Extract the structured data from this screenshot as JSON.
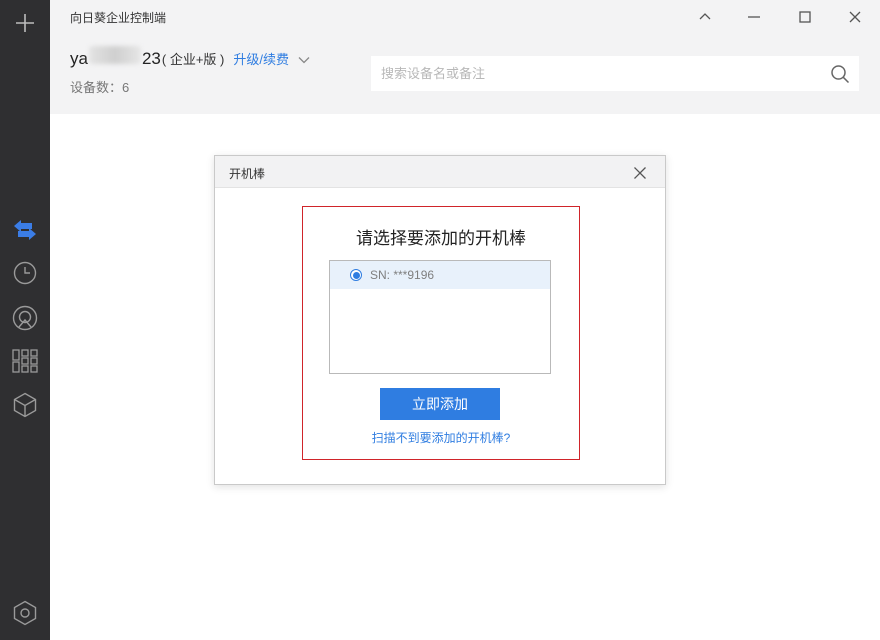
{
  "app": {
    "title": "向日葵企业控制端"
  },
  "account": {
    "name_prefix": "ya",
    "name_suffix": "23",
    "edition": "( 企业+版 )",
    "upgrade_label": "升级/续费"
  },
  "devices": {
    "count_label": "设备数：",
    "count": "6"
  },
  "search": {
    "placeholder": "搜索设备名或备注"
  },
  "dialog": {
    "title": "开机棒",
    "heading": "请选择要添加的开机棒",
    "items": [
      {
        "label": "SN: ***9196",
        "selected": true
      }
    ],
    "add_button": "立即添加",
    "help_link": "扫描不到要添加的开机棒?"
  },
  "colors": {
    "accent": "#2f7de1",
    "sidebar_bg": "#2f2f31",
    "highlight_border": "#d0242a"
  },
  "sidebar_icons": [
    "plus-icon",
    "transfer-icon",
    "clock-icon",
    "remote-icon",
    "apps-icon",
    "cube-icon",
    "settings-icon"
  ]
}
